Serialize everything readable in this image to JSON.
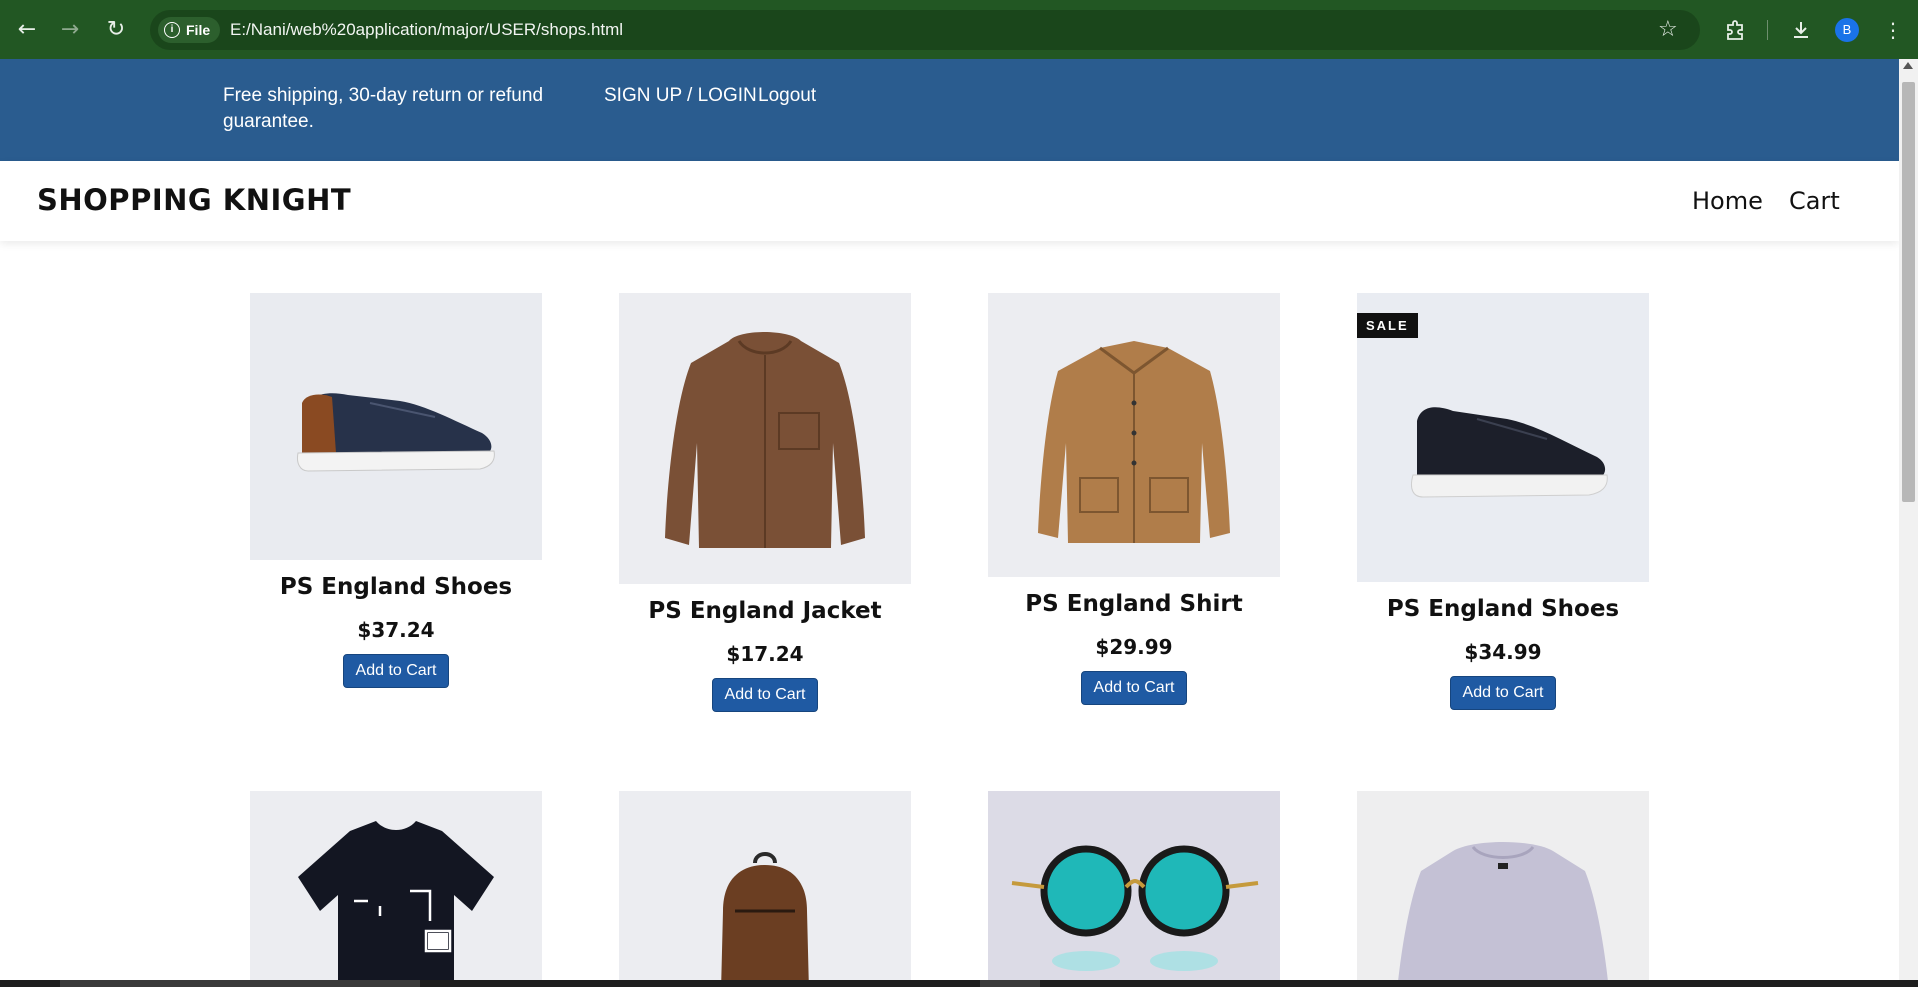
{
  "browser": {
    "file_chip": "File",
    "url": "E:/Nani/web%20application/major/USER/shops.html",
    "profile_initial": "B"
  },
  "topbar": {
    "promo": "Free shipping, 30-day return or refund guarantee.",
    "auth_link": "SIGN UP / LOGIN",
    "logout_link": "Logout"
  },
  "header": {
    "brand": "SHOPPING KNIGHT",
    "nav": [
      "Home",
      "Cart"
    ]
  },
  "products": [
    {
      "name": "PS England Shoes",
      "price": "$37.24",
      "button": "Add to Cart",
      "icon": "sneaker-brown-heel"
    },
    {
      "name": "PS England Jacket",
      "price": "$17.24",
      "button": "Add to Cart",
      "icon": "brown-hooded-jacket"
    },
    {
      "name": "PS England Shirt",
      "price": "$29.99",
      "button": "Add to Cart",
      "icon": "tan-overshirt"
    },
    {
      "name": "PS England Shoes",
      "price": "$34.99",
      "button": "Add to Cart",
      "icon": "black-sneaker",
      "badge": "SALE"
    },
    {
      "icon": "black-graphic-tshirt"
    },
    {
      "icon": "brown-backpack"
    },
    {
      "icon": "teal-round-sunglasses"
    },
    {
      "icon": "lavender-sweatshirt"
    }
  ],
  "colors": {
    "browser_bar": "#225723",
    "topbar": "#2a5c8f",
    "button": "#1f5aa3"
  }
}
